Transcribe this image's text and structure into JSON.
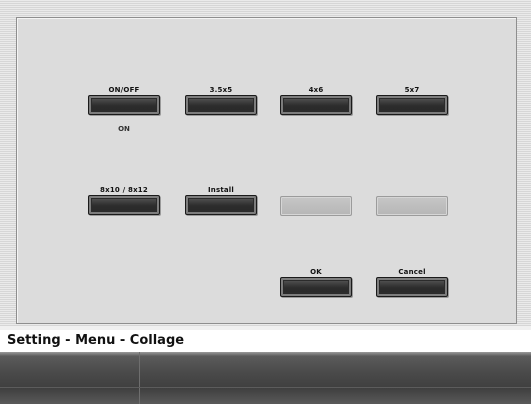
{
  "screen": {
    "title": "Setting - Menu - Collage"
  },
  "buttons": {
    "on_off": {
      "label": "ON/OFF",
      "status": "ON"
    },
    "size_35x5": {
      "label": "3.5x5"
    },
    "size_4x6": {
      "label": "4x6"
    },
    "size_5x7": {
      "label": "5x7"
    },
    "size_8x10": {
      "label": "8x10 / 8x12"
    },
    "install": {
      "label": "Install"
    },
    "ok": {
      "label": "OK"
    },
    "cancel": {
      "label": "Cancel"
    }
  }
}
